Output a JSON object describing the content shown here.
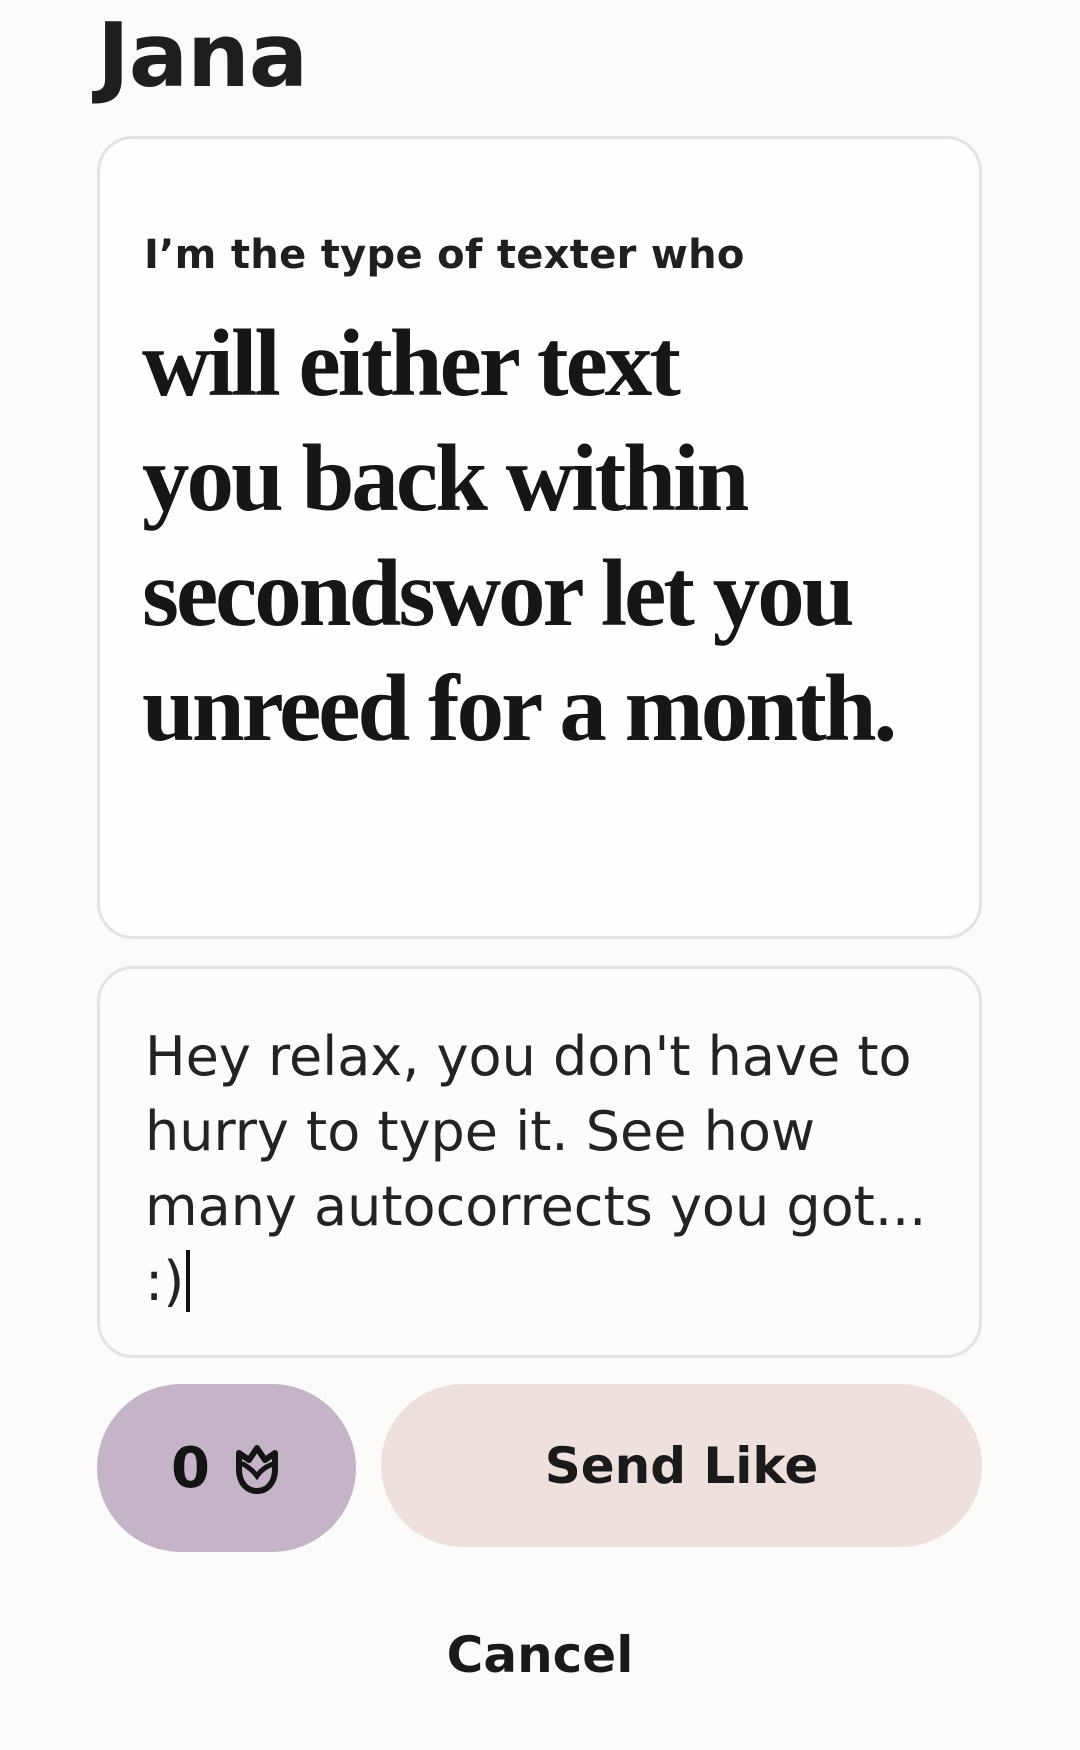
{
  "profile": {
    "name": "Jana"
  },
  "prompt": {
    "question": "I’m the type of texter who",
    "answer_lines": [
      "will either text",
      "you back within",
      "secondswor let you",
      "unreed for a month."
    ]
  },
  "comment": {
    "text": "Hey relax, you don't have to hurry to type it. See how many autocorrects you got... :)"
  },
  "actions": {
    "rose_count": "0",
    "rose_icon": "rose-icon",
    "send_label": "Send Like",
    "cancel_label": "Cancel"
  },
  "colors": {
    "rose_button_bg": "#c5b4c8",
    "send_button_bg": "#ede0dd",
    "page_bg": "#fcfbfa"
  }
}
